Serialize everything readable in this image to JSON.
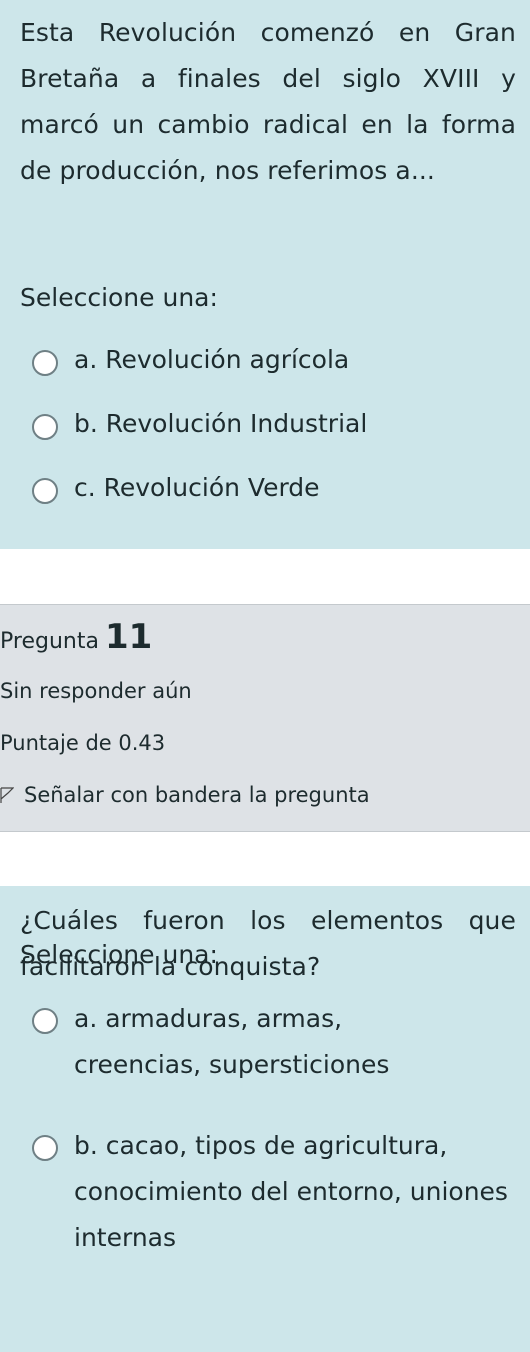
{
  "q10": {
    "question": "Esta Revolución comenzó en Gran Bretaña a finales del siglo XVIII y marcó un cambio radical en la forma de producción, nos referimos a...",
    "select_label": "Seleccione una:",
    "options": [
      {
        "label": "a. Revolución agrícola"
      },
      {
        "label": "b. Revolución Industrial"
      },
      {
        "label": "c. Revolución Verde"
      }
    ]
  },
  "q11_info": {
    "heading": "Pregunta",
    "number": "11",
    "state": "Sin responder aún",
    "grade": "Puntaje de 0.43",
    "flag_label": "Señalar con bandera la pregunta",
    "flag_icon": "flag-outline-icon"
  },
  "q11": {
    "question": "¿Cuáles fueron los elementos que facilitaron la conquista?",
    "select_label": "Seleccione una:",
    "options": [
      {
        "label": "a. armaduras, armas, creencias, supersticiones"
      },
      {
        "label": "b. cacao, tipos de agricultura, conocimiento del entorno, uniones internas"
      }
    ]
  },
  "colors": {
    "question_bg": "#cde6ea",
    "info_bg": "#dee2e6",
    "text": "#1d2b2e"
  }
}
